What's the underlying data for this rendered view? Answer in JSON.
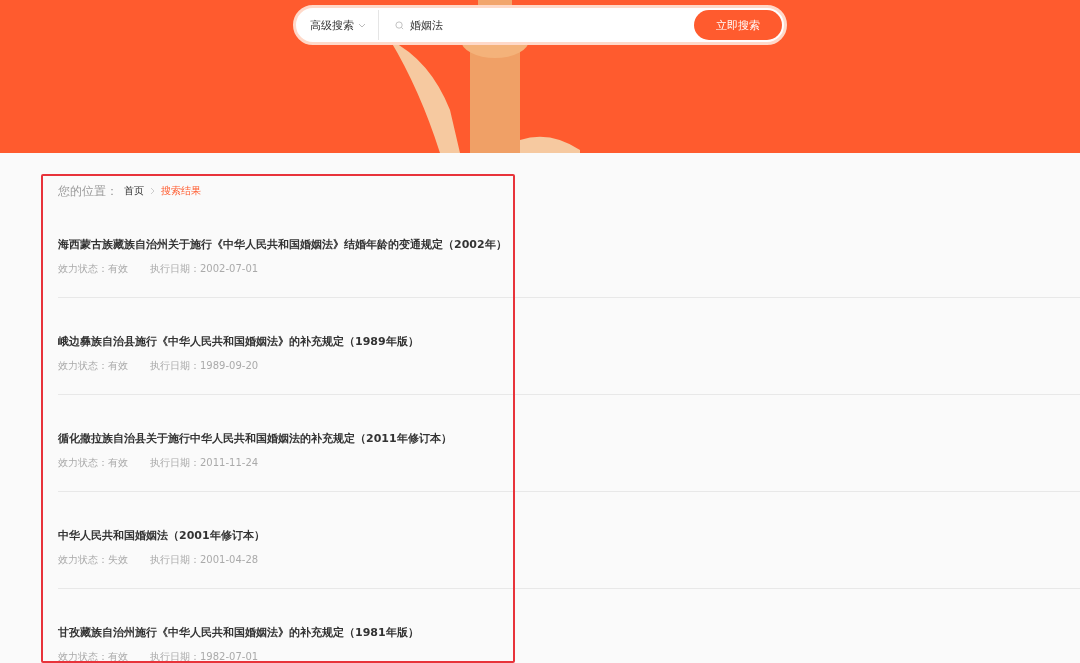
{
  "search": {
    "scope": "高级搜索",
    "query": "婚姻法",
    "button": "立即搜索"
  },
  "breadcrumb": {
    "label": "您的位置：",
    "items": [
      {
        "text": "首页",
        "selected": false
      },
      {
        "text": "搜索结果",
        "selected": true
      }
    ]
  },
  "results": [
    {
      "title": "海西蒙古族藏族自治州关于施行《中华人民共和国婚姻法》结婚年龄的变通规定（2002年）",
      "status": "效力状态：有效",
      "date": "执行日期：2002-07-01"
    },
    {
      "title": "峨边彝族自治县施行《中华人民共和国婚姻法》的补充规定（1989年版）",
      "status": "效力状态：有效",
      "date": "执行日期：1989-09-20"
    },
    {
      "title": "循化撒拉族自治县关于施行中华人民共和国婚姻法的补充规定（2011年修订本）",
      "status": "效力状态：有效",
      "date": "执行日期：2011-11-24"
    },
    {
      "title": "中华人民共和国婚姻法（2001年修订本）",
      "status": "效力状态：失效",
      "date": "执行日期：2001-04-28"
    },
    {
      "title": "甘孜藏族自治州施行《中华人民共和国婚姻法》的补充规定（1981年版）",
      "status": "效力状态：有效",
      "date": "执行日期：1982-07-01"
    }
  ]
}
